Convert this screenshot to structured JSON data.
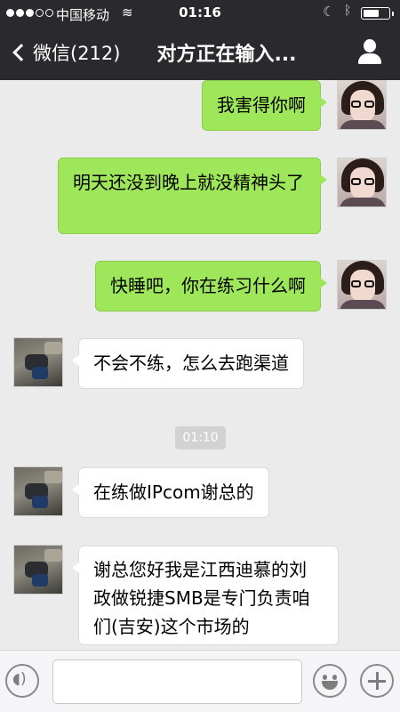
{
  "status_bar": {
    "carrier": "中国移动",
    "time": "01:16"
  },
  "nav": {
    "back_label": "微信(212)",
    "title": "对方正在输入..."
  },
  "messages": [
    {
      "direction": "sent",
      "text": "我害得你啊"
    },
    {
      "direction": "sent",
      "text": "明天还没到晚上就没精神头了"
    },
    {
      "direction": "sent",
      "text": "快睡吧，你在练习什么啊"
    },
    {
      "direction": "received",
      "text": "不会不练，怎么去跑渠道"
    },
    {
      "direction": "received",
      "text": "在练做IPcom谢总的"
    },
    {
      "direction": "received",
      "text": "谢总您好我是江西迪慕的刘政做锐捷SMB是专门负责咱们(吉安)这个市场的"
    }
  ],
  "time_separator": "01:10",
  "input_bar": {
    "value": ""
  },
  "colors": {
    "sent_bubble": "#9fe75a",
    "received_bubble": "#ffffff",
    "nav_background": "#2a2a2e",
    "chat_background": "#ebebeb"
  },
  "icons": [
    "wifi-icon",
    "moon-icon",
    "bluetooth-icon",
    "battery-icon",
    "back-chevron-icon",
    "person-icon",
    "voice-icon",
    "emoji-icon",
    "plus-icon"
  ]
}
